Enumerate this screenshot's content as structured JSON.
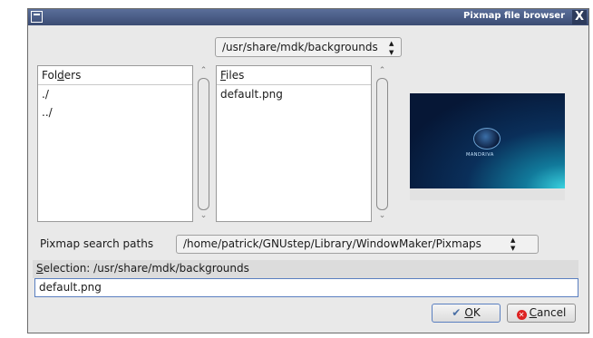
{
  "window": {
    "title": "Pixmap file browser",
    "close_glyph": "X"
  },
  "path_selector": {
    "value": "/usr/share/mdk/backgrounds",
    "arrows": "▲▼"
  },
  "folders": {
    "header_prefix": "Fol",
    "header_mnemonic": "d",
    "header_suffix": "ers",
    "items": [
      "./",
      "../"
    ]
  },
  "files": {
    "header_mnemonic": "F",
    "header_suffix": "iles",
    "items": [
      "default.png"
    ]
  },
  "preview": {
    "label": "MANDRIVA"
  },
  "search_paths": {
    "label": "Pixmap search paths",
    "value": "/home/patrick/GNUstep/Library/WindowMaker/Pixmaps",
    "arrows": "▲▼"
  },
  "selection": {
    "label_mnemonic": "S",
    "label_suffix": "election: /usr/share/mdk/backgrounds",
    "filename": "default.png"
  },
  "buttons": {
    "ok_mnemonic": "O",
    "ok_suffix": "K",
    "cancel_mnemonic": "C",
    "cancel_suffix": "ancel"
  },
  "icons": [
    "window-menu-icon",
    "close-icon",
    "check-icon",
    "cancel-icon",
    "scroll-up-icon",
    "scroll-down-icon"
  ]
}
